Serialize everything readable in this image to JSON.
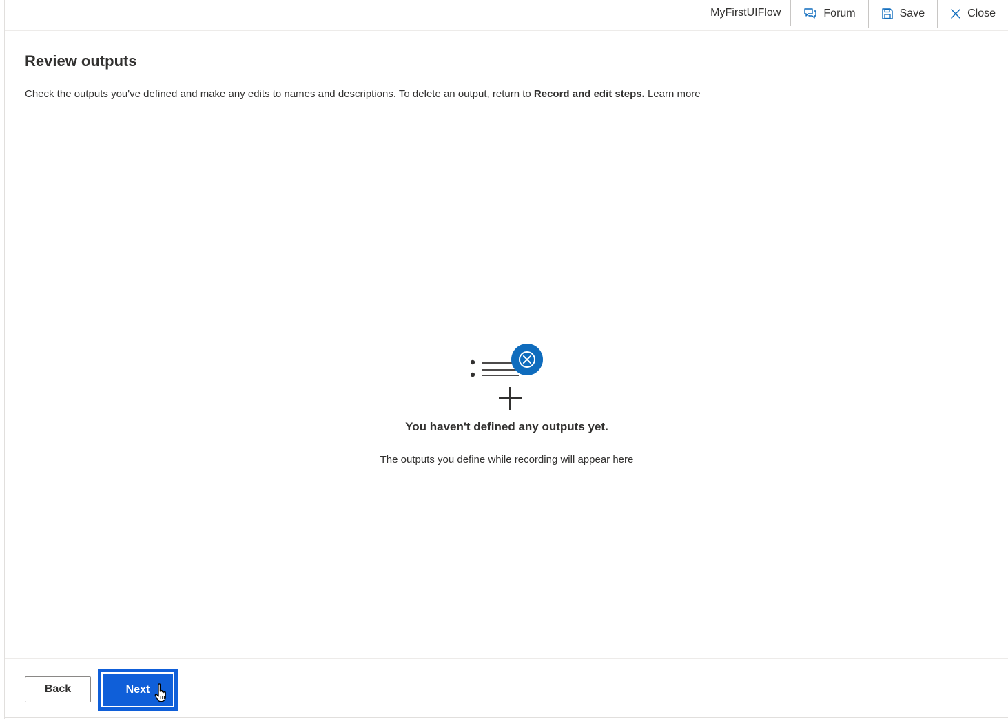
{
  "topbar": {
    "flow_name": "MyFirstUIFlow",
    "forum_label": "Forum",
    "save_label": "Save",
    "close_label": "Close"
  },
  "page": {
    "title": "Review outputs",
    "description_prefix": "Check the outputs you've defined and make any edits to names and descriptions. To delete an output, return to ",
    "description_bold": "Record and edit steps.",
    "description_link": "Learn more"
  },
  "empty_state": {
    "title": "You haven't defined any outputs yet.",
    "subtitle": "The outputs you define while recording will appear here",
    "icon": "outputs-list-remove-icon",
    "accent_color": "#0f6cbd"
  },
  "footer": {
    "back_label": "Back",
    "next_label": "Next"
  },
  "colors": {
    "primary": "#0f5fd9",
    "text": "#323130",
    "border": "#8a8886"
  }
}
